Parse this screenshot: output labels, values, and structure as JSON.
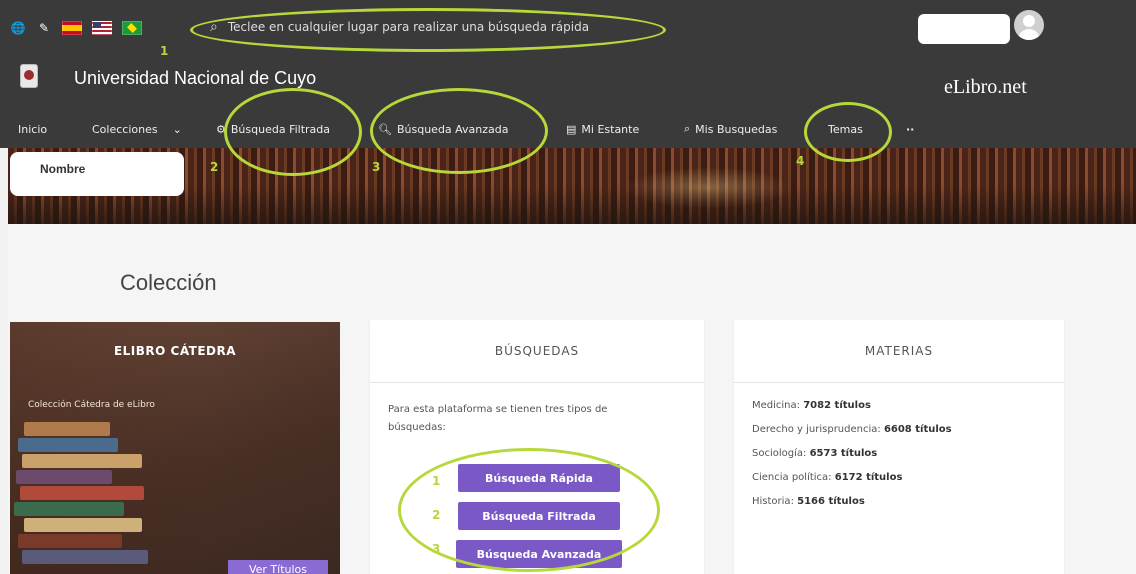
{
  "header": {
    "search_placeholder": "Teclee en cualquier lugar para realizar una búsqueda rápida",
    "university": "Universidad Nacional de Cuyo",
    "brand": "eLibro.net",
    "user_name": "Nombre"
  },
  "nav": {
    "items": [
      {
        "label": "Inicio",
        "icon": ""
      },
      {
        "label": "Colecciones",
        "icon": "chevron-down-icon"
      },
      {
        "label": "Búsqueda Filtrada",
        "icon": "filter-icon"
      },
      {
        "label": "Búsqueda Avanzada",
        "icon": "search-icon"
      },
      {
        "label": "Mi Estante",
        "icon": "bookshelf-icon"
      },
      {
        "label": "Mis Busquedas",
        "icon": "search-icon"
      },
      {
        "label": "Temas",
        "icon": ""
      },
      {
        "label": "··",
        "icon": "more-icon"
      }
    ]
  },
  "main": {
    "title": "Colección",
    "catedra": {
      "title": "ELIBRO CÁTEDRA",
      "description": "Colección Cátedra de eLibro",
      "button": "Ver Títulos"
    },
    "busquedas": {
      "title": "BÚSQUEDAS",
      "text": "Para esta plataforma se tienen tres tipos de búsquedas:",
      "buttons": [
        "Búsqueda Rápida",
        "Búsqueda Filtrada",
        "Búsqueda Avanzada"
      ]
    },
    "materias": {
      "title": "MATERIAS",
      "items": [
        {
          "name": "Medicina:",
          "count": "7082 títulos"
        },
        {
          "name": "Derecho y jurisprudencia:",
          "count": "6608 títulos"
        },
        {
          "name": "Sociología:",
          "count": "6573 títulos"
        },
        {
          "name": "Ciencia política:",
          "count": "6172 títulos"
        },
        {
          "name": "Historia:",
          "count": "5166 títulos"
        }
      ]
    }
  },
  "annotations": {
    "n1": "1",
    "n2": "2",
    "n3": "3",
    "n4": "4",
    "b1": "1",
    "b2": "2",
    "b3": "3",
    "color": "#b6d83a"
  },
  "colors": {
    "header": "#3a3a3a",
    "button_purple": "#7a59c7"
  }
}
